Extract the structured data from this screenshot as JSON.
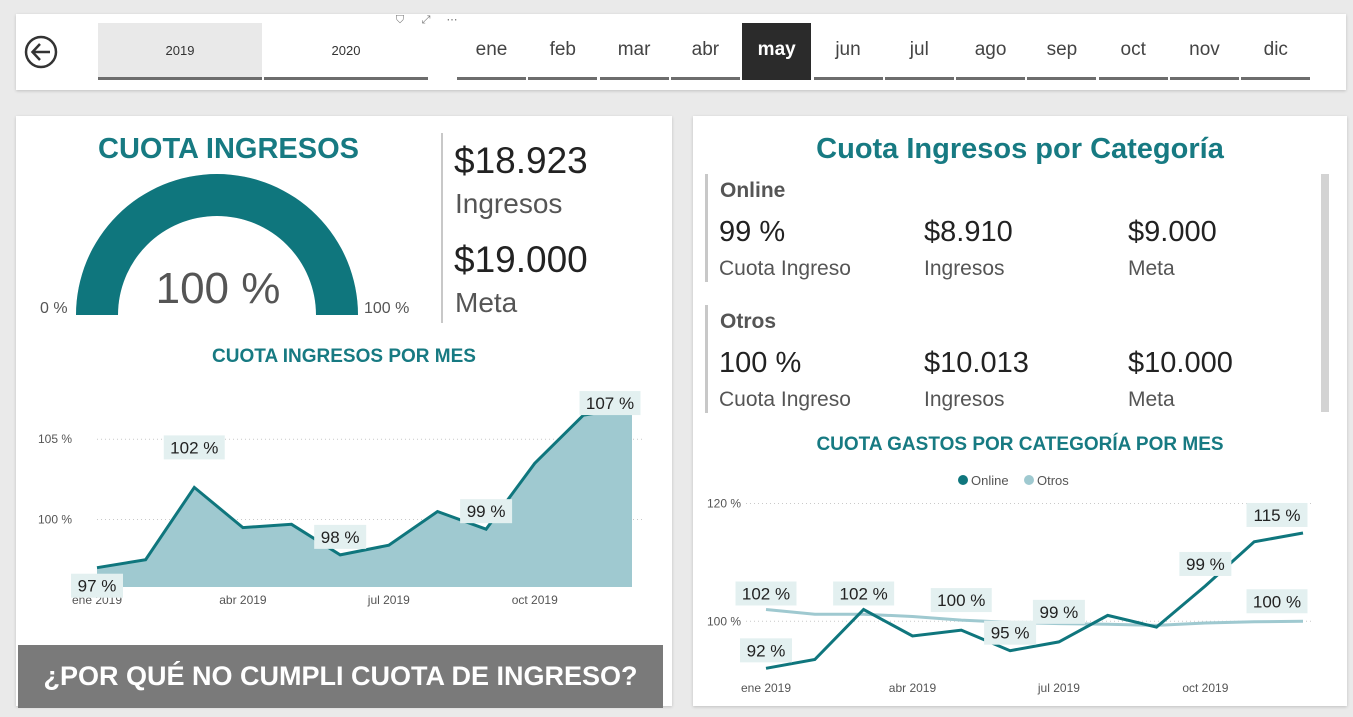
{
  "slicers": {
    "years": [
      {
        "label": "2019",
        "selected": true
      },
      {
        "label": "2020",
        "selected": false
      }
    ],
    "months": [
      {
        "label": "ene",
        "selected": false
      },
      {
        "label": "feb",
        "selected": false
      },
      {
        "label": "mar",
        "selected": false
      },
      {
        "label": "abr",
        "selected": false
      },
      {
        "label": "may",
        "selected": true
      },
      {
        "label": "jun",
        "selected": false
      },
      {
        "label": "jul",
        "selected": false
      },
      {
        "label": "ago",
        "selected": false
      },
      {
        "label": "sep",
        "selected": false
      },
      {
        "label": "oct",
        "selected": false
      },
      {
        "label": "nov",
        "selected": false
      },
      {
        "label": "dic",
        "selected": false
      }
    ]
  },
  "left": {
    "gauge": {
      "title": "CUOTA INGRESOS",
      "value_label": "100 %",
      "min_label": "0 %",
      "max_label": "100 %",
      "fill_fraction": 1.0,
      "color": "#0f767d"
    },
    "kpis": {
      "ingresos_value": "$18.923",
      "ingresos_label": "Ingresos",
      "meta_value": "$19.000",
      "meta_label": "Meta"
    },
    "cta_label": "¿POR QUÉ NO CUMPLI CUOTA DE INGRESO?"
  },
  "right": {
    "title": "Cuota Ingresos por Categoría",
    "categories": [
      {
        "name": "Online",
        "cuota": "99 %",
        "cuota_label": "Cuota Ingreso",
        "ingresos": "$8.910",
        "ingresos_label": "Ingresos",
        "meta": "$9.000",
        "meta_label": "Meta"
      },
      {
        "name": "Otros",
        "cuota": "100 %",
        "cuota_label": "Cuota Ingreso",
        "ingresos": "$10.013",
        "ingresos_label": "Ingresos",
        "meta": "$10.000",
        "meta_label": "Meta"
      }
    ]
  },
  "colors": {
    "teal": "#177a82",
    "area_fill": "#9fc9d0",
    "line_dark": "#0f767d",
    "line_light": "#9fc9d0",
    "label_bg": "#e3f0f0"
  },
  "chart_data": [
    {
      "type": "area",
      "title": "CUOTA INGRESOS POR MES",
      "x": [
        "ene 2019",
        "feb 2019",
        "mar 2019",
        "abr 2019",
        "may 2019",
        "jun 2019",
        "jul 2019",
        "ago 2019",
        "sep 2019",
        "oct 2019",
        "nov 2019",
        "dic 2019"
      ],
      "x_ticks": [
        "ene 2019",
        "abr 2019",
        "jul 2019",
        "oct 2019"
      ],
      "values": [
        97,
        97.5,
        102,
        99.5,
        99.7,
        97.8,
        98.4,
        100.5,
        99.4,
        103.5,
        106.5,
        107
      ],
      "data_labels": [
        {
          "i": 0,
          "text": "97 %"
        },
        {
          "i": 2,
          "text": "102 %"
        },
        {
          "i": 5,
          "text": "98 %"
        },
        {
          "i": 8,
          "text": "99 %"
        },
        {
          "i": 11,
          "text": "107 %"
        }
      ],
      "y_ticks": [
        {
          "v": 100,
          "label": "100 %"
        },
        {
          "v": 105,
          "label": "105 %"
        }
      ],
      "ylim": [
        95.8,
        108
      ],
      "grid": true
    },
    {
      "type": "line",
      "title": "CUOTA GASTOS POR CATEGORÍA POR MES",
      "x": [
        "ene 2019",
        "feb 2019",
        "mar 2019",
        "abr 2019",
        "may 2019",
        "jun 2019",
        "jul 2019",
        "ago 2019",
        "sep 2019",
        "oct 2019",
        "nov 2019",
        "dic 2019"
      ],
      "x_ticks": [
        "ene 2019",
        "abr 2019",
        "jul 2019",
        "oct 2019"
      ],
      "series": [
        {
          "name": "Online",
          "values": [
            92,
            93.5,
            102,
            97.5,
            98.5,
            95,
            96.5,
            101,
            99,
            106,
            113.5,
            115
          ],
          "data_labels": [
            {
              "i": 0,
              "text": "92 %"
            },
            {
              "i": 2,
              "text": "102 %"
            },
            {
              "i": 5,
              "text": "95 %"
            },
            {
              "i": 6,
              "text": "99 %"
            },
            {
              "i": 9,
              "text": "99 %"
            },
            {
              "i": 11,
              "text": "115 %"
            }
          ]
        },
        {
          "name": "Otros",
          "values": [
            102,
            101.2,
            101.2,
            100.8,
            100.2,
            99.8,
            99.6,
            99.5,
            99.3,
            99.7,
            99.9,
            100
          ],
          "data_labels": [
            {
              "i": 0,
              "text": "102 %"
            },
            {
              "i": 4,
              "text": "100 %"
            },
            {
              "i": 11,
              "text": "100 %"
            }
          ]
        }
      ],
      "legend": [
        "Online",
        "Otros"
      ],
      "legend_position": "top-center",
      "y_ticks": [
        {
          "v": 100,
          "label": "100 %"
        },
        {
          "v": 120,
          "label": "120 %"
        }
      ],
      "ylim": [
        89,
        124
      ],
      "grid": true
    }
  ]
}
